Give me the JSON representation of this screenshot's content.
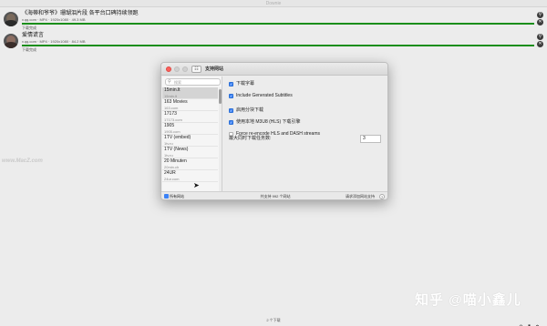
{
  "app": {
    "title": "Downie"
  },
  "downloads": [
    {
      "title": "《海蒂和爷爷》珊瑚泪片段 各平台口碑持续领跑",
      "meta": "v.qq.com · MP4 · 1920x1080 · 49.3 MB",
      "status": "下载完成",
      "progress": 1.0
    },
    {
      "title": "爱情谎言",
      "meta": "v.qq.com · MP4 · 1920x1080 · 84.2 MB",
      "status": "下载完成",
      "progress": 1.0
    }
  ],
  "dialog": {
    "title": "支持网站",
    "search_placeholder": "搜索",
    "sites": [
      {
        "name": "15min.lt",
        "domain": "15min.lt",
        "selected": true
      },
      {
        "name": "163 Movies",
        "domain": "163.com",
        "selected": false
      },
      {
        "name": "17173",
        "domain": "17173.com",
        "selected": false
      },
      {
        "name": "1905",
        "domain": "1905.com",
        "selected": false
      },
      {
        "name": "1TV (embed)",
        "domain": "1tv.ru",
        "selected": false
      },
      {
        "name": "1TV (News)",
        "domain": "1tv.ru",
        "selected": false
      },
      {
        "name": "20 Minuten",
        "domain": "20min.ch",
        "selected": false
      },
      {
        "name": "24UR",
        "domain": "24ur.com",
        "selected": false
      }
    ],
    "options": [
      {
        "label": "下载字幕",
        "checked": true
      },
      {
        "label": "Include Generated Subtitles",
        "checked": true
      },
      {
        "label": "启用分块下载",
        "checked": true
      },
      {
        "label": "使用本地 M3U8 (HLS) 下载引擎",
        "checked": true
      },
      {
        "label": "Force re-encode HLS and DASH streams",
        "checked": false
      }
    ],
    "max_downloads_label": "最大同时下载任务数:",
    "max_downloads_value": "3",
    "footer": {
      "all_sites": "所有网站",
      "total": "共支持 992 个网站",
      "request": "请求添加网站支持",
      "help": "?"
    }
  },
  "footer": {
    "count": "2 个下载"
  },
  "watermarks": {
    "left": "www.MacZ.com",
    "right": "知乎 @喵小鑫儿"
  },
  "colors": {
    "progress": "#1a8e1a",
    "accent": "#3b82f6",
    "close": "#fc605c"
  }
}
